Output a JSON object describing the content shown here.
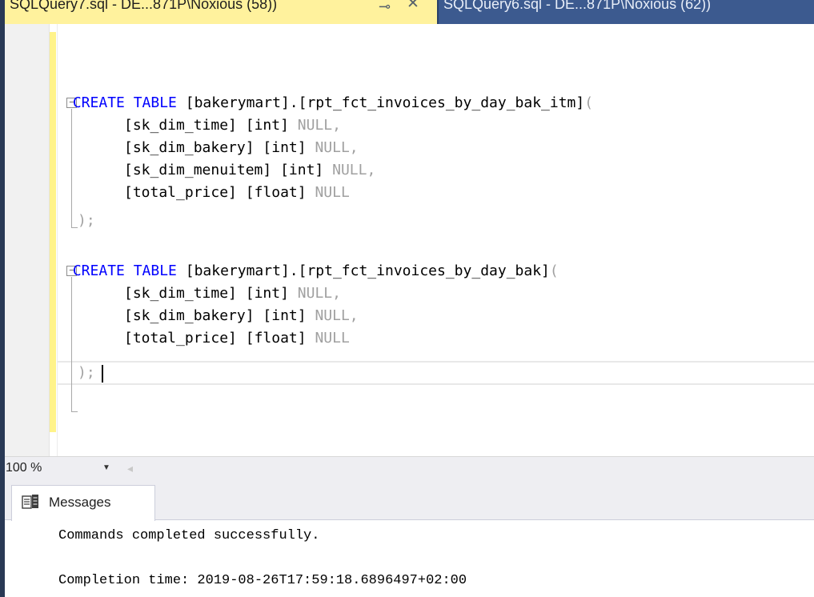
{
  "tabs": [
    {
      "label": "SQLQuery7.sql - DE...871P\\Noxious (58))",
      "pin": "⊸",
      "close": "✕",
      "active": true
    },
    {
      "label": "SQLQuery6.sql - DE...871P\\Noxious (62))",
      "active": false
    }
  ],
  "editor": {
    "statements": [
      {
        "keyword": "CREATE TABLE",
        "table": "[bakerymart].[rpt_fct_invoices_by_day_bak_itm]",
        "open": "(",
        "columns": [
          {
            "name": "[sk_dim_time]",
            "type": "[int]",
            "nullability": "NULL",
            "sep": ","
          },
          {
            "name": "[sk_dim_bakery]",
            "type": "[int]",
            "nullability": "NULL",
            "sep": ","
          },
          {
            "name": "[sk_dim_menuitem]",
            "type": "[int]",
            "nullability": "NULL",
            "sep": ","
          },
          {
            "name": "[total_price]",
            "type": "[float]",
            "nullability": "NULL",
            "sep": ""
          }
        ],
        "close": ");"
      },
      {
        "keyword": "CREATE TABLE",
        "table": "[bakerymart].[rpt_fct_invoices_by_day_bak]",
        "open": "(",
        "columns": [
          {
            "name": "[sk_dim_time]",
            "type": "[int]",
            "nullability": "NULL",
            "sep": ","
          },
          {
            "name": "[sk_dim_bakery]",
            "type": "[int]",
            "nullability": "NULL",
            "sep": ","
          },
          {
            "name": "[total_price]",
            "type": "[float]",
            "nullability": "NULL",
            "sep": ""
          }
        ],
        "close": ");"
      }
    ],
    "collapse_glyph": "−"
  },
  "statusbar": {
    "zoom": "100 %",
    "zoom_arrow": "▼",
    "scroll_left": "◂"
  },
  "results": {
    "tab_label": "Messages",
    "lines": [
      "Commands completed successfully.",
      "Completion time: 2019-08-26T17:59:18.6896497+02:00"
    ]
  },
  "colors": {
    "keyword": "#0000ff",
    "null": "#a0a0a0",
    "active_tab": "#fff29d",
    "inactive_tab": "#3c5a8f",
    "frame": "#293955"
  }
}
